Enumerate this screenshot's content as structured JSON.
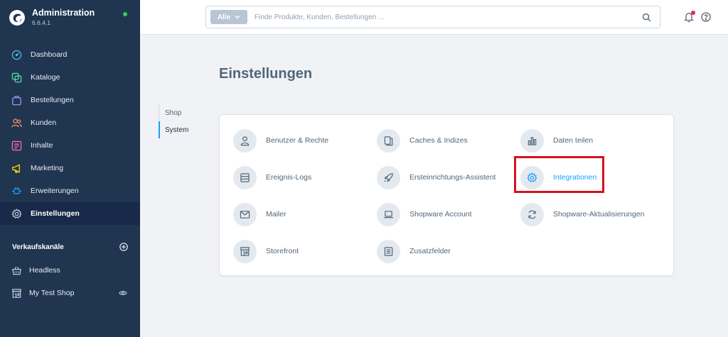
{
  "brand": {
    "title": "Administration",
    "version": "6.6.4.1",
    "status_color": "#37d046"
  },
  "nav": [
    {
      "name": "dashboard",
      "label": "Dashboard",
      "icon": "gauge-icon",
      "color": "#52b6e6"
    },
    {
      "name": "kataloge",
      "label": "Kataloge",
      "icon": "copy-icon",
      "color": "#57d9a3"
    },
    {
      "name": "bestellungen",
      "label": "Bestellungen",
      "icon": "shopping-bag-icon",
      "color": "#a092f0"
    },
    {
      "name": "kunden",
      "label": "Kunden",
      "icon": "users-icon",
      "color": "#f88962"
    },
    {
      "name": "inhalte",
      "label": "Inhalte",
      "icon": "content-icon",
      "color": "#ff68b4"
    },
    {
      "name": "marketing",
      "label": "Marketing",
      "icon": "megaphone-icon",
      "color": "#ffd700"
    },
    {
      "name": "erweiterungen",
      "label": "Erweiterungen",
      "icon": "plug-icon",
      "color": "#189eff"
    },
    {
      "name": "einstellungen",
      "label": "Einstellungen",
      "icon": "cog-icon",
      "color": "#9aa8b5",
      "active": true
    }
  ],
  "sales_channels": {
    "heading": "Verkaufskanäle",
    "items": [
      {
        "label": "Headless",
        "icon": "basket-icon"
      },
      {
        "label": "My Test Shop",
        "icon": "storefront-icon",
        "eye": true
      }
    ]
  },
  "search": {
    "type_label": "Alle",
    "placeholder": "Finde Produkte, Kunden, Bestellungen ..."
  },
  "page": {
    "title": "Einstellungen"
  },
  "tabs": [
    {
      "label": "Shop",
      "active": false
    },
    {
      "label": "System",
      "active": true
    }
  ],
  "settings": [
    {
      "label": "Benutzer & Rechte",
      "icon": "user-icon"
    },
    {
      "label": "Caches & Indizes",
      "icon": "files-icon"
    },
    {
      "label": "Daten teilen",
      "icon": "chart-bars-icon"
    },
    {
      "label": "Ereignis-Logs",
      "icon": "list-icon"
    },
    {
      "label": "Ersteinrichtungs-Assistent",
      "icon": "rocket-icon"
    },
    {
      "label": "Integrationen",
      "icon": "cog-icon",
      "highlighted": true
    },
    {
      "label": "Mailer",
      "icon": "envelope-icon"
    },
    {
      "label": "Shopware Account",
      "icon": "laptop-icon"
    },
    {
      "label": "Shopware-Aktualisierungen",
      "icon": "sync-icon"
    },
    {
      "label": "Storefront",
      "icon": "storefront-icon"
    },
    {
      "label": "Zusatzfelder",
      "icon": "document-icon"
    }
  ],
  "colors": {
    "accent": "#189eff",
    "sidebar": "#1f3550",
    "highlight_border": "#d6121c",
    "notification": "#de294c"
  }
}
